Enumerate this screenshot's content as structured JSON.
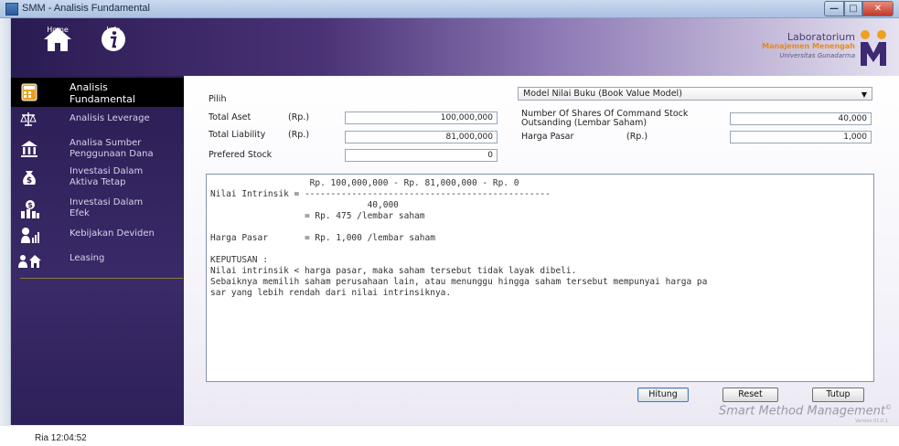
{
  "window": {
    "title": "SMM - Analisis Fundamental",
    "min_label": "—",
    "max_label": "□",
    "close_label": "✕"
  },
  "header": {
    "home_label": "Home",
    "info_label": "Info",
    "logo_line1": "Laboratorium",
    "logo_line2": "Manajemen Menengah",
    "logo_line3": "Universitas Gunadarma"
  },
  "sidebar": {
    "items": [
      {
        "label_1": "Analisis",
        "label_2": "Fundamental",
        "icon": "calculator-icon",
        "active": true
      },
      {
        "label_1": "Analisis Leverage",
        "label_2": "",
        "icon": "balance-icon",
        "active": false
      },
      {
        "label_1": "Analisa Sumber",
        "label_2": "Penggunaan Dana",
        "icon": "bank-icon",
        "active": false
      },
      {
        "label_1": "Investasi Dalam",
        "label_2": "Aktiva Tetap",
        "icon": "money-bag-icon",
        "active": false
      },
      {
        "label_1": "Investasi Dalam",
        "label_2": "Efek",
        "icon": "stocks-icon",
        "active": false
      },
      {
        "label_1": "Kebijakan Deviden",
        "label_2": "",
        "icon": "dividend-chart-icon",
        "active": false
      },
      {
        "label_1": "Leasing",
        "label_2": "",
        "icon": "leasing-icon",
        "active": false
      }
    ]
  },
  "form": {
    "pilih_label": "Pilih",
    "model_selected": "Model Nilai Buku (Book Value Model)",
    "total_aset_label": "Total Aset",
    "total_aset_unit": "(Rp.)",
    "total_aset_value": "100,000,000",
    "total_liability_label": "Total Liability",
    "total_liability_unit": "(Rp.)",
    "total_liability_value": "81,000,000",
    "prefered_stock_label": "Prefered Stock",
    "prefered_stock_value": "0",
    "shares_label_1": "Number Of Shares Of Command Stock",
    "shares_label_2": "Outsanding (Lembar Saham)",
    "shares_value": "40,000",
    "harga_pasar_label": "Harga Pasar",
    "harga_pasar_unit": "(Rp.)",
    "harga_pasar_value": "1,000"
  },
  "result": {
    "lines": [
      "                   Rp. 100,000,000 - Rp. 81,000,000 - Rp. 0",
      "Nilai Intrinsik = -----------------------------------------------",
      "                              40,000",
      "                  = Rp. 475 /lembar saham",
      "",
      "Harga Pasar       = Rp. 1,000 /lembar saham",
      "",
      "KEPUTUSAN :",
      "Nilai intrinsik < harga pasar, maka saham tersebut tidak layak dibeli.",
      "Sebaiknya memilih saham perusahaan lain, atau menunggu hingga saham tersebut mempunyai harga pa",
      "sar yang lebih rendah dari nilai intrinsiknya."
    ]
  },
  "buttons": {
    "hitung": "Hitung",
    "reset": "Reset",
    "tutup": "Tutup"
  },
  "branding": {
    "watermark": "Smart Method Management",
    "trademark": "©",
    "version": "Version 01.0.1"
  },
  "status": {
    "text": "Ria  12:04:52"
  },
  "colors": {
    "sidebar_bg": "#2c1d55",
    "active_item_bg": "#000000",
    "logo_accent": "#e88a1a"
  }
}
